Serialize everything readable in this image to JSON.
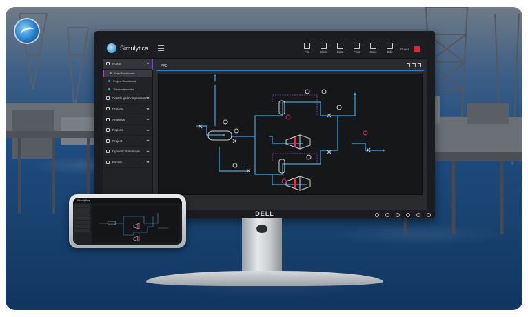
{
  "app": {
    "name": "Simulytica"
  },
  "toolbar": {
    "items": [
      {
        "label": "File",
        "icon": "file-icon"
      },
      {
        "label": "Client",
        "icon": "monitor-icon"
      },
      {
        "label": "Data",
        "icon": "data-icon"
      },
      {
        "label": "Print",
        "icon": "print-icon"
      },
      {
        "label": "Save",
        "icon": "save-icon"
      },
      {
        "label": "Edit",
        "icon": "edit-icon"
      }
    ],
    "user_label": "Guest"
  },
  "sidebar": {
    "home_label": "Home",
    "sub_items": [
      "Main Dashboard",
      "Project Dashboard",
      "Thermodynamics"
    ],
    "items": [
      {
        "label": "Centrifugal Compressors",
        "icon": "compressor-icon"
      },
      {
        "label": "Process",
        "icon": "flask-icon"
      },
      {
        "label": "Analytics",
        "icon": "bar-chart-icon"
      },
      {
        "label": "Reports",
        "icon": "reports-icon"
      },
      {
        "label": "Project",
        "icon": "folder-icon"
      },
      {
        "label": "Dynamic Simulation",
        "icon": "gauge-icon"
      },
      {
        "label": "Facility",
        "icon": "building-icon"
      }
    ]
  },
  "panel": {
    "title": "PFD"
  },
  "monitor": {
    "brand": "DELL"
  },
  "phone": {
    "brand": "Simulytica"
  },
  "colors": {
    "accent": "#1d7ed8",
    "pipe": "#38a8e8",
    "signal": "#e03050",
    "highlight": "#8a3ed0"
  }
}
